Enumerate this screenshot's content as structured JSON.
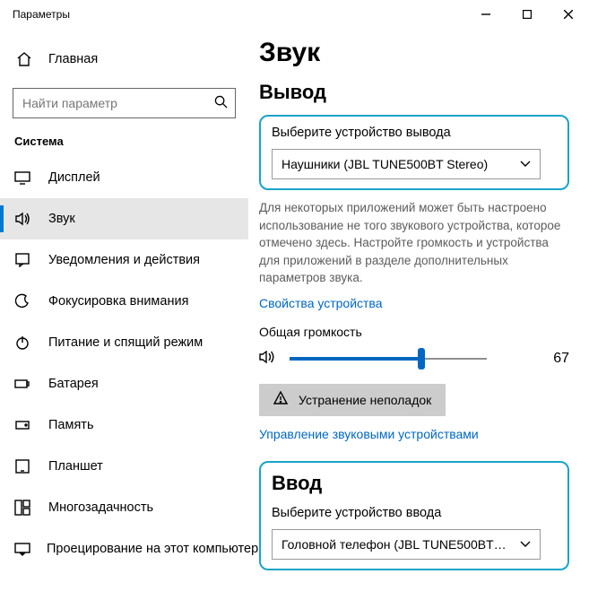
{
  "window": {
    "title": "Параметры"
  },
  "sidebar": {
    "home_label": "Главная",
    "search_placeholder": "Найти параметр",
    "group_label": "Система",
    "items": [
      {
        "label": "Дисплей"
      },
      {
        "label": "Звук"
      },
      {
        "label": "Уведомления и действия"
      },
      {
        "label": "Фокусировка внимания"
      },
      {
        "label": "Питание и спящий режим"
      },
      {
        "label": "Батарея"
      },
      {
        "label": "Память"
      },
      {
        "label": "Планшет"
      },
      {
        "label": "Многозадачность"
      },
      {
        "label": "Проецирование на этот компьютер"
      }
    ]
  },
  "main": {
    "page_title": "Звук",
    "output": {
      "heading": "Вывод",
      "select_label": "Выберите устройство вывода",
      "selected_device": "Наушники (JBL TUNE500BT Stereo)",
      "description": "Для некоторых приложений может быть настроено использование не того звукового устройства, которое отмечено здесь. Настройте громкость и устройства для приложений в разделе дополнительных параметров звука.",
      "device_properties_link": "Свойства устройства",
      "volume_label": "Общая громкость",
      "volume_value": "67",
      "troubleshoot_label": "Устранение неполадок",
      "manage_devices_link": "Управление звуковыми устройствами"
    },
    "input": {
      "heading": "Ввод",
      "select_label": "Выберите устройство ввода",
      "selected_device": "Головной телефон (JBL TUNE500BT…"
    }
  }
}
